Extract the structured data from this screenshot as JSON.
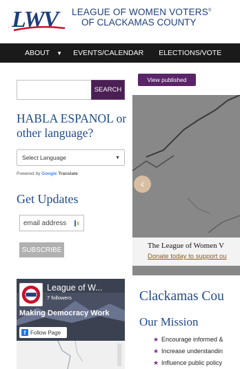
{
  "header": {
    "logo_text": "LWV",
    "org_line1": "LEAGUE OF WOMEN VOTERS",
    "org_line1_mark": "®",
    "org_line2": "OF CLACKAMAS COUNTY"
  },
  "nav": {
    "about": "ABOUT",
    "events": "EVENTS/CALENDAR",
    "elections": "ELECTIONS/VOTE"
  },
  "sidebar": {
    "search_placeholder": "",
    "search_button": "SEARCH",
    "language_heading": "HABLA ESPANOL or other language?",
    "language_select": "Select Language",
    "powered_by": "Powered by",
    "google": "Google",
    "translate": "Translate",
    "updates_heading": "Get Updates",
    "email_placeholder": "email address",
    "subscribe_button": "SUBSCRIBE",
    "facebook": {
      "page_name": "League of W...",
      "followers": "7 followers",
      "banner_text": "Making Democracy Work",
      "follow_button": "Follow Page"
    }
  },
  "main": {
    "view_published": "View published",
    "slide_title": "The League of Women V",
    "slide_link": "Donate today to support ou",
    "page_heading": "Clackamas Cou",
    "mission_heading": "Our Mission",
    "mission_items": [
      "Encourage informed &",
      "Increase understandin",
      "Influence public policy"
    ]
  },
  "colors": {
    "brand_blue": "#1f4a8a",
    "brand_purple": "#4a1f53",
    "logo_red": "#c8102e",
    "nav_bg": "#1a1a1a"
  }
}
